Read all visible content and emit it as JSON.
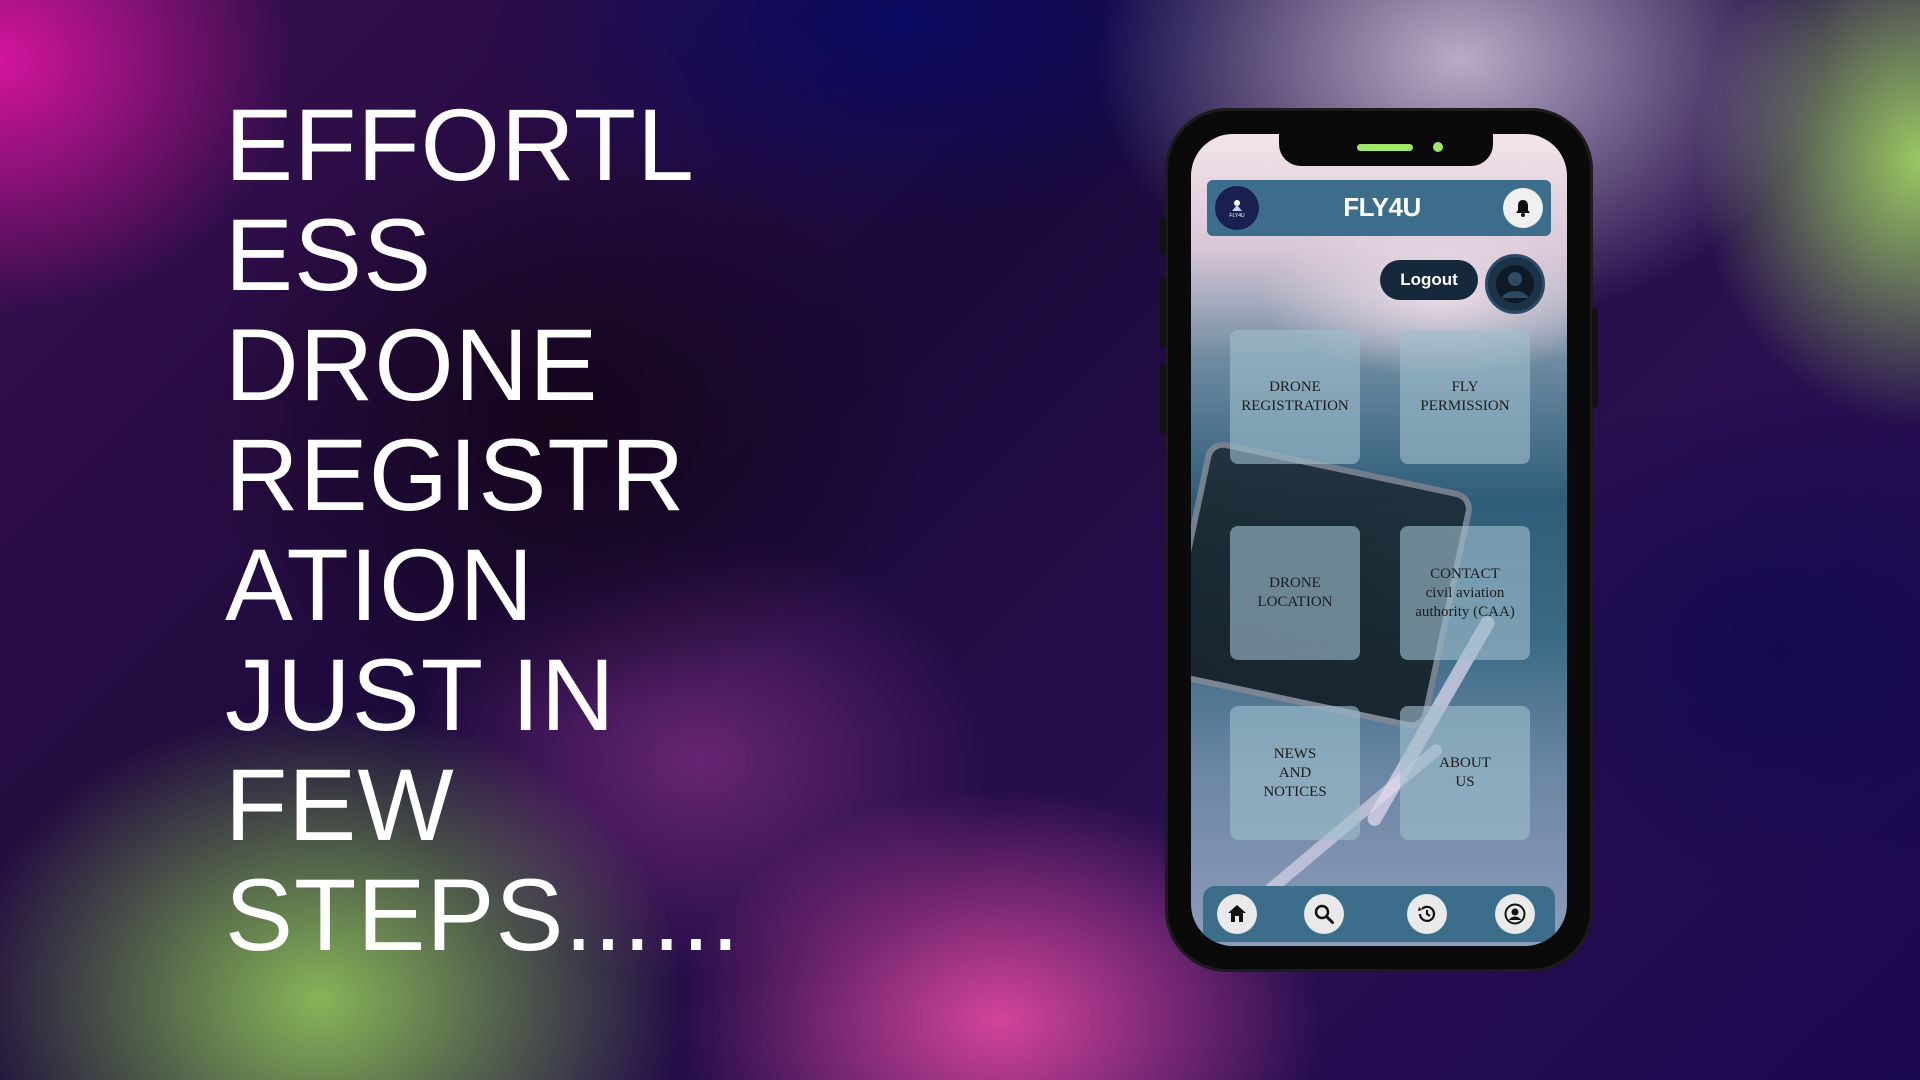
{
  "headline": "EFFORTL\nESS\nDRONE\nREGISTR\nATION\nJUST IN\nFEW\nSTEPS......",
  "app": {
    "title": "FLY4U",
    "logo_text": "FLY4U",
    "logout_label": "Logout"
  },
  "tiles": [
    {
      "label": "DRONE\nREGISTRATION"
    },
    {
      "label": "FLY\nPERMISSION"
    },
    {
      "label": "DRONE\nLOCATION"
    },
    {
      "label": "CONTACT\ncivil aviation\nauthority (CAA)"
    },
    {
      "label": "NEWS\nAND\nNOTICES"
    },
    {
      "label": "ABOUT\nUS"
    }
  ],
  "bottom_nav": [
    {
      "icon": "home-icon"
    },
    {
      "icon": "search-icon"
    },
    {
      "icon": "history-icon"
    },
    {
      "icon": "profile-icon"
    }
  ],
  "colors": {
    "bar": "#3c6e8c",
    "logout_bg": "#16283c",
    "notch_accent": "#9ee86a"
  }
}
